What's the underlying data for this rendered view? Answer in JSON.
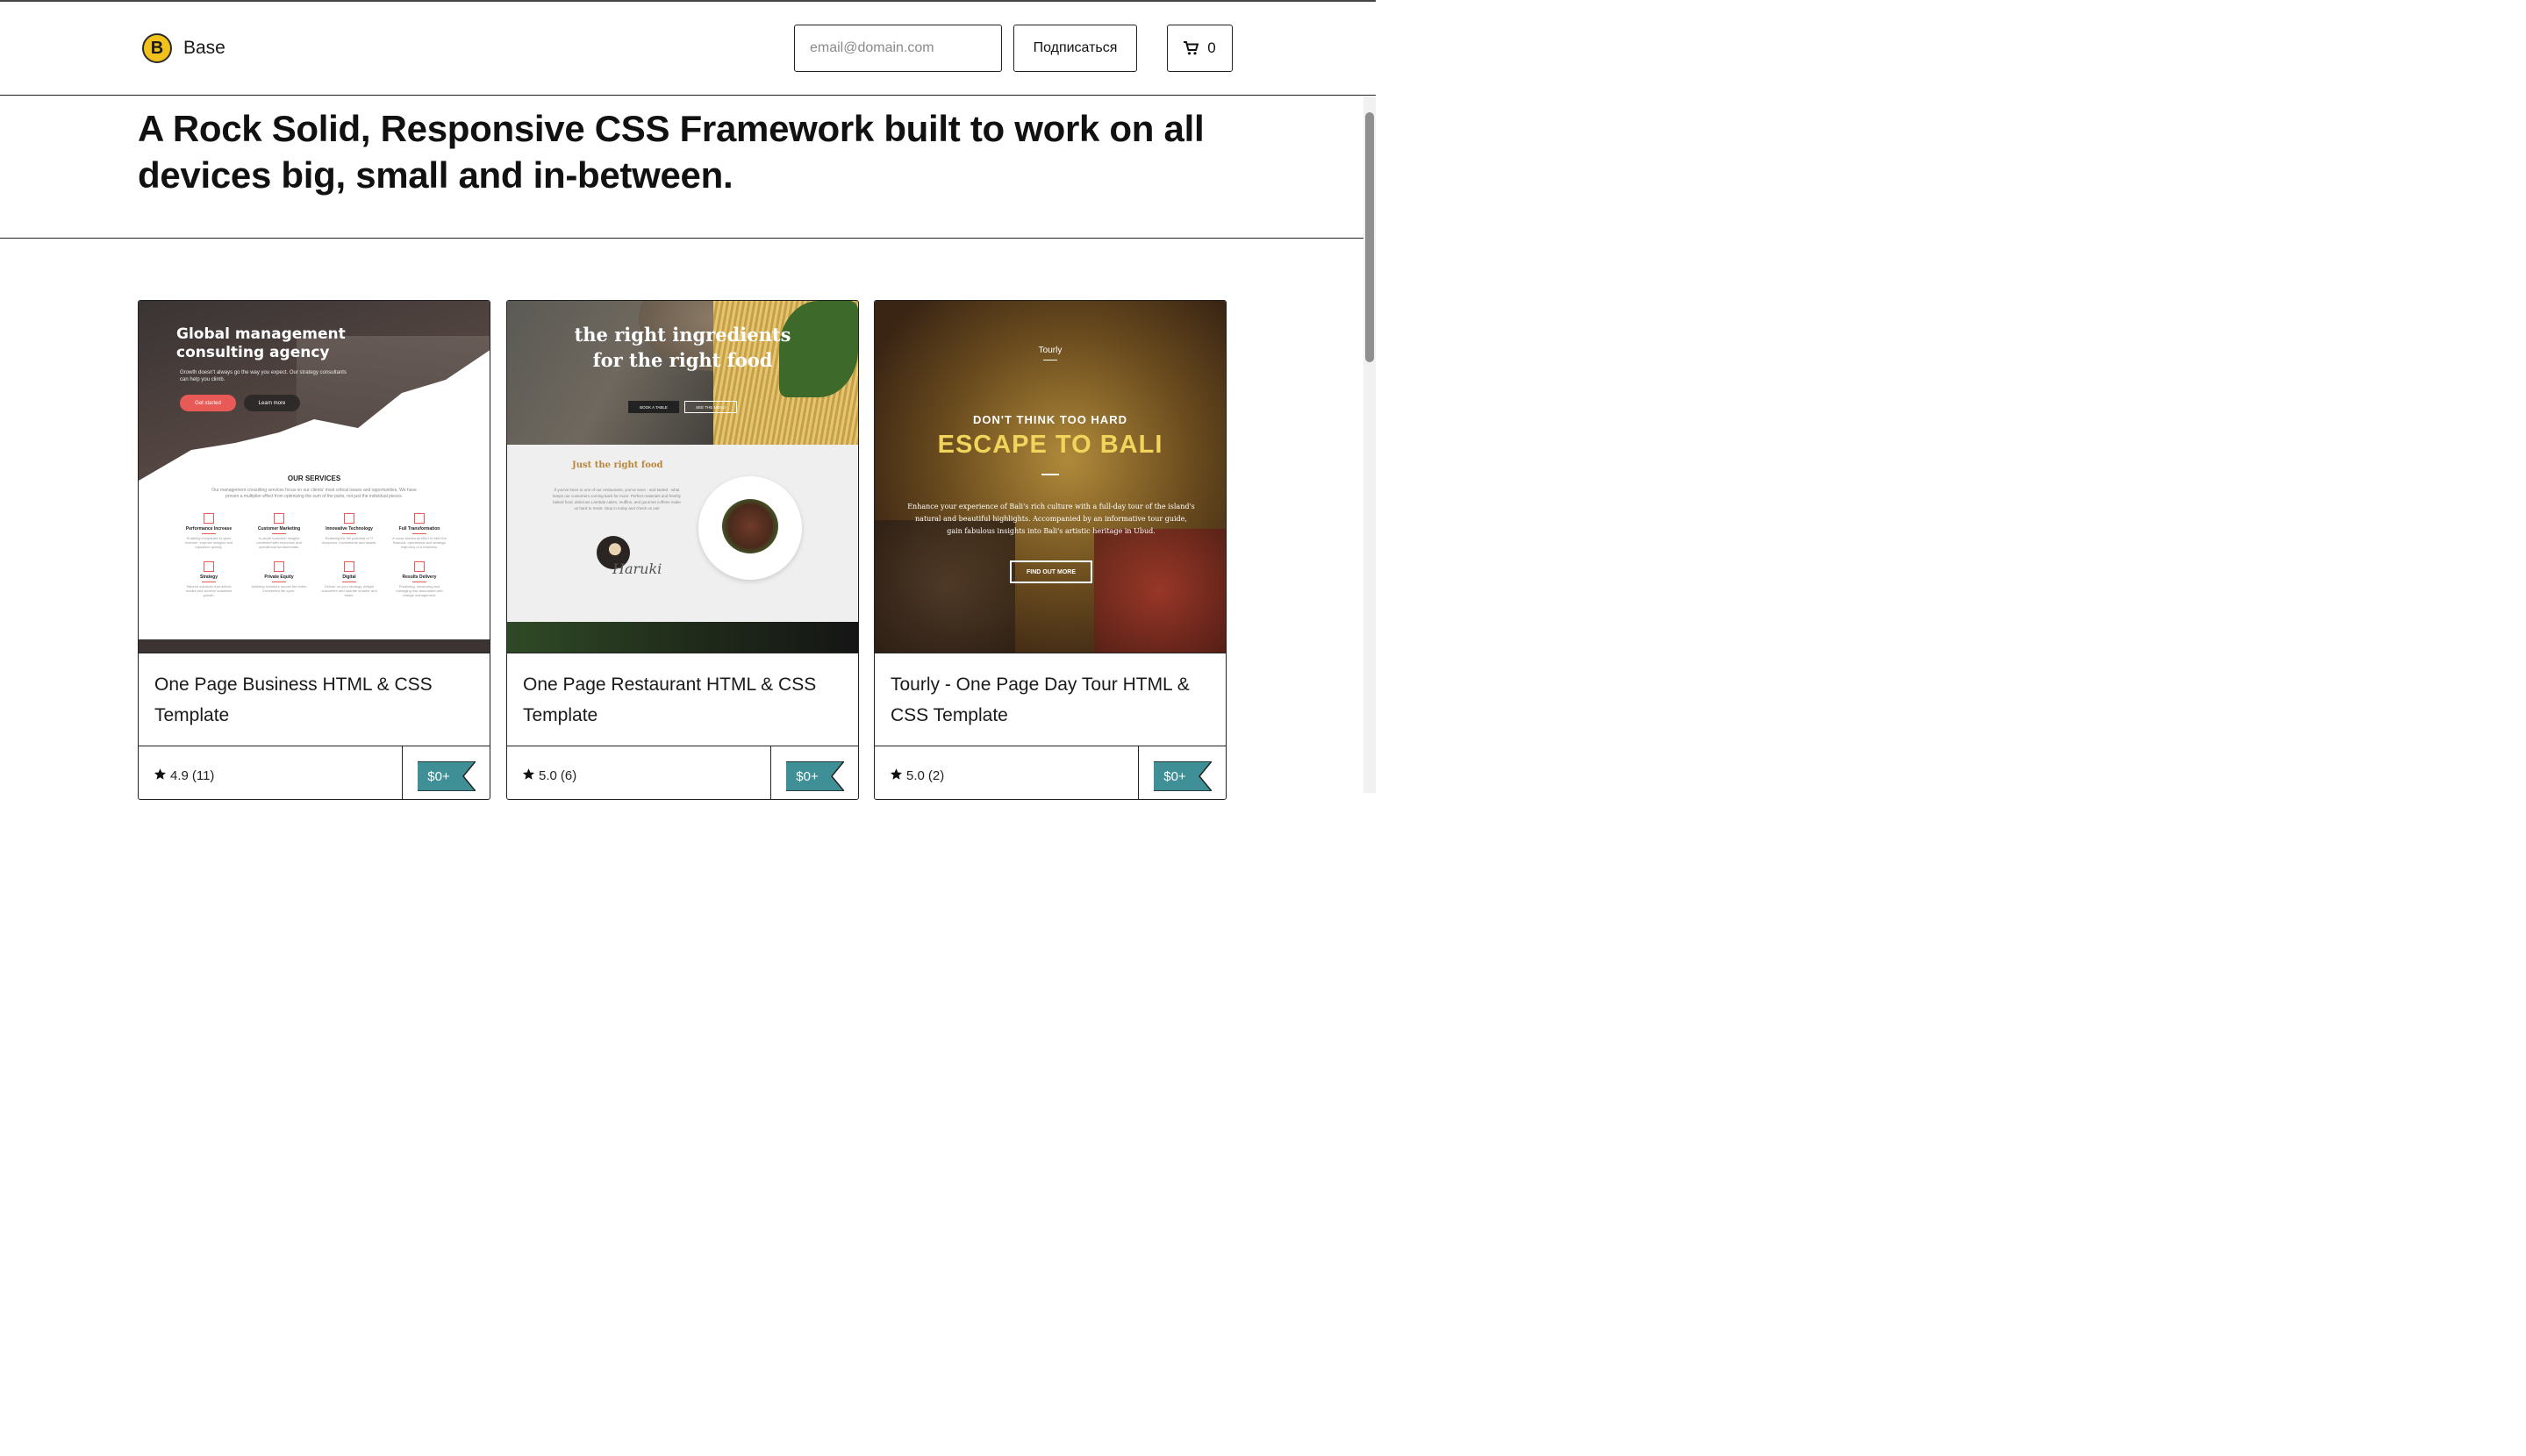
{
  "header": {
    "brand_name": "Base",
    "logo_letter": "B",
    "email_placeholder": "email@domain.com",
    "subscribe_label": "Подписаться",
    "cart_count": "0",
    "cart_icon": "cart-icon"
  },
  "hero": {
    "headline": "A Rock Solid, Responsive CSS Framework built to work on all devices big, small and in-between."
  },
  "colors": {
    "price_tag": "#3f8f96",
    "accent_red": "#e85a55",
    "gold": "#f0d45c"
  },
  "cards": [
    {
      "title": "One Page Business HTML & CSS Template",
      "rating": "4.9",
      "reviews": "(11)",
      "price": "$0+",
      "thumb": {
        "headline": "Global management consulting agency",
        "sub": "Growth doesn't always go the way you expect. Our strategy consultants can help you climb.",
        "btn_primary": "Get started",
        "btn_secondary": "Learn more",
        "services_title": "OUR SERVICES",
        "services_desc": "Our management consulting services focus on our clients' most critical issues and opportunities. We have proven a multiplier effect from optimizing the sum of the parts, not just the individual pieces.",
        "items": [
          {
            "name": "Performance Increase",
            "desc": "Enabling companies to grow revenue, improve margins and reposition quickly."
          },
          {
            "name": "Customer Marketing",
            "desc": "In-depth customer insights combined with economic and operational fundamentals."
          },
          {
            "name": "Innovative Technology",
            "desc": "Realizing the full potential of IT resources, investments and assets."
          },
          {
            "name": "Full Transformation",
            "desc": "A cross-functional effort to alter the financial, operational and strategic trajectory of a business."
          },
          {
            "name": "Strategy",
            "desc": "Tailored solutions that deliver results and achieve sustained growth."
          },
          {
            "name": "Private Equity",
            "desc": "Advising investors across the entire investment life cycle."
          },
          {
            "name": "Digital",
            "desc": "Deliver on your strategy, delight customers and operate smarter and faster."
          },
          {
            "name": "Results Delivery",
            "desc": "Predicting, measuring and managing risk associated with change management."
          }
        ]
      }
    },
    {
      "title": "One Page Restaurant HTML & CSS Template",
      "rating": "5.0",
      "reviews": "(6)",
      "price": "$0+",
      "thumb": {
        "headline_1": "the right ingredients",
        "headline_2": "for the right food",
        "btn_primary": "BOOK A TABLE",
        "btn_secondary": "SEE THE MENU",
        "section_title": "Just the right food",
        "para": "If you've been to one of our restaurants, you've seen - and tasted - what keeps our customers coming back for more. Perfect materials and freshly baked food, delicious Lambda cakes, muffins, and gourmet coffees make us hard to resist. Stop in today and check us out!",
        "signature": "Haruki"
      }
    },
    {
      "title": "Tourly - One Page Day Tour HTML & CSS Template",
      "rating": "5.0",
      "reviews": "(2)",
      "price": "$0+",
      "thumb": {
        "brand": "Tourly",
        "kicker": "DON'T THINK TOO HARD",
        "headline": "ESCAPE TO BALI",
        "desc": "Enhance your experience of Bali's rich culture with a full-day tour of the island's natural and beautiful highlights. Accompanied by an informative tour guide, gain fabulous insights into Bali's artistic heritage in Ubud.",
        "btn": "FIND OUT MORE"
      }
    }
  ]
}
